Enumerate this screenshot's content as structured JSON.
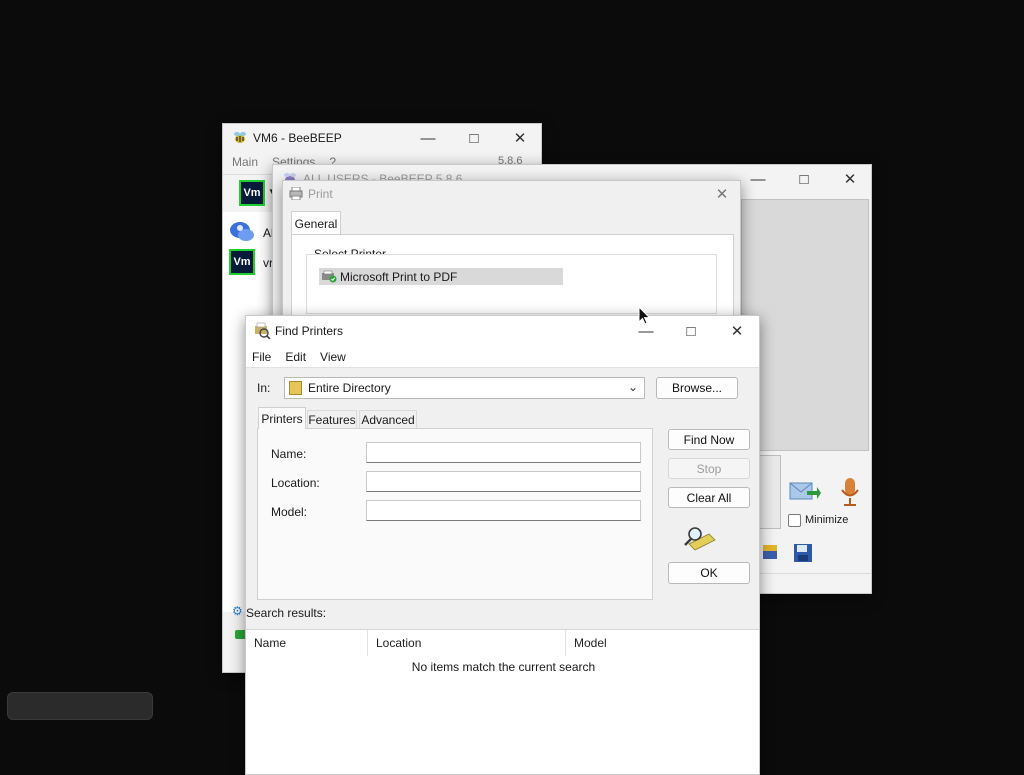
{
  "beebeep_vm6": {
    "title": "VM6 - BeeBEEP",
    "menu": [
      "Main",
      "Settings",
      "?"
    ],
    "version": "5.8.6",
    "badge": "Vm",
    "list_items": [
      {
        "label": "Al"
      },
      {
        "label": "vr"
      }
    ]
  },
  "beebeep_all_users": {
    "title": "ALL USERS - BeeBEEP 5.8.6",
    "minimize_label": "Minimize"
  },
  "print_dialog": {
    "title": "Print",
    "tab": "General",
    "group_label": "Select Printer",
    "printer": "Microsoft Print to PDF"
  },
  "find_printers": {
    "title": "Find Printers",
    "menu": [
      "File",
      "Edit",
      "View"
    ],
    "in_label": "In:",
    "in_value": "Entire Directory",
    "browse_label": "Browse...",
    "tabs": [
      "Printers",
      "Features",
      "Advanced"
    ],
    "fields": [
      {
        "label": "Name:",
        "value": ""
      },
      {
        "label": "Location:",
        "value": ""
      },
      {
        "label": "Model:",
        "value": ""
      }
    ],
    "buttons": {
      "find_now": "Find Now",
      "stop": "Stop",
      "clear_all": "Clear All",
      "ok": "OK"
    },
    "search_results_label": "Search results:",
    "columns": [
      "Name",
      "Location",
      "Model"
    ],
    "empty_message": "No items match the current search"
  },
  "colors": {
    "desktop": "#0b0b0b",
    "window_bg": "#f3f3f3",
    "accent_green": "#1fcf2f",
    "badge_bg": "#061a3a"
  }
}
